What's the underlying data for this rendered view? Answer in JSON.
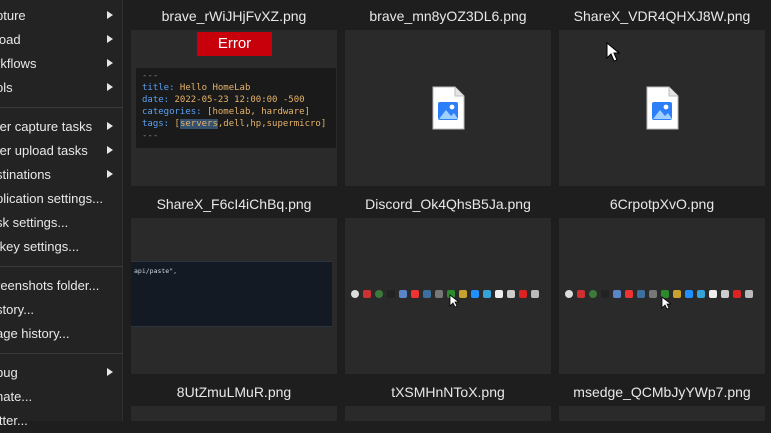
{
  "menu": {
    "items": [
      {
        "label": "pture",
        "submenu": true
      },
      {
        "label": "load",
        "submenu": true
      },
      {
        "label": "rkflows",
        "submenu": true
      },
      {
        "label": "ols",
        "submenu": true
      },
      {
        "label": "ter capture tasks",
        "submenu": true
      },
      {
        "label": "ter upload tasks",
        "submenu": true
      },
      {
        "label": "stinations",
        "submenu": true
      },
      {
        "label": "plication settings...",
        "submenu": false
      },
      {
        "label": "sk settings...",
        "submenu": false
      },
      {
        "label": "tkey settings...",
        "submenu": false
      },
      {
        "label": "reenshots folder...",
        "submenu": false
      },
      {
        "label": "story...",
        "submenu": false
      },
      {
        "label": "age history...",
        "submenu": false
      },
      {
        "label": "bug",
        "submenu": true
      },
      {
        "label": "nate...",
        "submenu": false
      },
      {
        "label": "itter...",
        "submenu": false
      }
    ]
  },
  "grid": {
    "files": [
      {
        "name": "brave_rWiJHjFvXZ.png",
        "preview": "error"
      },
      {
        "name": "brave_mn8yOZ3DL6.png",
        "preview": "icon"
      },
      {
        "name": "ShareX_VDR4QHXJ8W.png",
        "preview": "icon"
      },
      {
        "name": "ShareX_F6cI4iChBq.png",
        "preview": "terminal"
      },
      {
        "name": "Discord_Ok4QhsB5Ja.png",
        "preview": "tray"
      },
      {
        "name": "6CrpotpXvO.png",
        "preview": "tray"
      },
      {
        "name": "8UtZmuLMuR.png",
        "preview": "blank"
      },
      {
        "name": "tXSMHnNToX.png",
        "preview": "blank"
      },
      {
        "name": "msedge_QCMbJyYWp7.png",
        "preview": "blank"
      }
    ]
  },
  "error_preview": {
    "badge": "Error",
    "lines": {
      "dash1": "---",
      "title_key": "title:",
      "title_val": " Hello HomeLab",
      "date_key": "date:",
      "date_val": " 2022-05-23 12:00:00 -500",
      "cat_key": "categories:",
      "cat_val": " [homelab, hardware]",
      "tags_key": "tags:",
      "tags_val_open": " [",
      "tags_hl": "servers",
      "tags_val_rest": ",dell,hp,supermicro]",
      "dash2": "---"
    }
  },
  "terminal_preview": {
    "text": "api/paste\","
  },
  "colors": {
    "error": "#c8000b",
    "background": "#1e1e1e",
    "thumb": "#2a2a2a"
  }
}
